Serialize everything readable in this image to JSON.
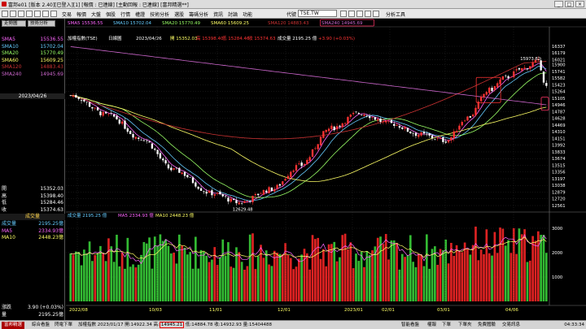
{
  "window": {
    "title": "富邦e01 [版本 2.40][已登入][1] [報價 : 已連線] [主動回報 : 已連線] [富邦精選**]",
    "buttons": [
      "_",
      "□",
      "×"
    ]
  },
  "toolbar": {
    "menus": [
      "交易",
      "報價",
      "大盤",
      "個股",
      "行情",
      "權證",
      "技術分析",
      "選股",
      "籌碼分析",
      "資訊",
      "討論",
      "功能"
    ],
    "symbol_label": "代號",
    "symbol": "TSE.TW",
    "analysis_tool": "分析工具"
  },
  "left_panel": {
    "tabs": [
      "走勢圖",
      "技術分析"
    ],
    "ma_rows": [
      {
        "name": "SMA5",
        "value": "15536.55",
        "color": "#ff66ff"
      },
      {
        "name": "SMA10",
        "value": "15702.04",
        "color": "#66ccff"
      },
      {
        "name": "SMA20",
        "value": "15770.49",
        "color": "#99ff66"
      },
      {
        "name": "SMA60",
        "value": "15609.25",
        "color": "#ffff66"
      },
      {
        "name": "SMA120",
        "value": "14883.43",
        "color": "#cc3333"
      },
      {
        "name": "SMA240",
        "value": "14945.69",
        "color": "#cc66cc"
      }
    ],
    "date": "2023/04/26",
    "ohlc": [
      {
        "k": "開",
        "v": "15352.03",
        "color": "#ffffff"
      },
      {
        "k": "高",
        "v": "15398.40",
        "color": "#ffffff"
      },
      {
        "k": "低",
        "v": "15284.46",
        "color": "#ffffff"
      },
      {
        "k": "收",
        "v": "15374.63",
        "color": "#ffffff"
      }
    ],
    "volume_header": "成交量",
    "vol_rows": [
      {
        "k": "成交量",
        "v": "2195.25億",
        "color": "#66ccff"
      },
      {
        "k": "MA5",
        "v": "2334.93億",
        "color": "#ff66ff"
      },
      {
        "k": "MA10",
        "v": "2448.23億",
        "color": "#ffff66"
      }
    ],
    "bottom_rows": [
      {
        "k": "漲跌",
        "v": "3.90 (+0.03%)",
        "color": "#ffffff"
      },
      {
        "k": "量",
        "v": "2195.25億",
        "color": "#ffffff"
      }
    ]
  },
  "chart_data": {
    "type": "candlestick",
    "title": "加權指數(TSE)",
    "period": "日線圖",
    "date": "2023/04/26",
    "open": "15352.03",
    "high": "15398.40",
    "low": "15284.46",
    "close": "15374.63",
    "vol_label": "成交量",
    "volume_text": "2195.25 億",
    "change": "+3.90 (+0.03%)",
    "ma_legend": [
      {
        "name": "SMA5",
        "value": "15536.55",
        "color": "#ff66ff"
      },
      {
        "name": "SMA10",
        "value": "15702.04",
        "color": "#66ccff"
      },
      {
        "name": "SMA20",
        "value": "15770.49",
        "color": "#99ff66"
      },
      {
        "name": "SMA60",
        "value": "15609.25",
        "color": "#ffff66"
      },
      {
        "name": "SMA120",
        "value": "14883.43",
        "color": "#cc3333"
      },
      {
        "name": "SMA240",
        "value": "14945.69",
        "color": "#cc66cc"
      }
    ],
    "y_ticks": [
      16337,
      16179,
      16021,
      15900,
      15741,
      15582,
      15423,
      15264,
      15105,
      14946,
      14787,
      14628,
      14469,
      14310,
      14151,
      13992,
      13833,
      13674,
      13515,
      13356,
      13197,
      13038,
      12879,
      12720,
      12561
    ],
    "y_range": [
      12561,
      16337
    ],
    "x_labels": [
      "2022/08",
      "10/03",
      "11/01",
      "12/01",
      "2023/01",
      "02/01",
      "03/01",
      "04/06"
    ],
    "annotations": [
      {
        "text": "15973.82",
        "value": 15973.82
      },
      {
        "text": "12629.48",
        "value": 12629.48
      }
    ],
    "volume_panel": {
      "legend": [
        {
          "name": "成交量",
          "value": "2195.25 億",
          "color": "#66ccff"
        },
        {
          "name": "MA5",
          "value": "2334.93 億",
          "color": "#ff66ff"
        },
        {
          "name": "MA10",
          "value": "2448.23 億",
          "color": "#ffff66"
        }
      ],
      "y_ticks": [
        3000,
        2000,
        1000
      ],
      "y_range": [
        0,
        3400
      ]
    },
    "colors": {
      "up": "#ff3333",
      "down": "#ffffff",
      "vol_up": "#dd2222",
      "vol_down": "#33bb33",
      "axis": "#ffffff",
      "grid": "#333333"
    }
  },
  "statusbar": {
    "tabs": [
      "富邦精選",
      "綜合看盤",
      "閃電下單"
    ],
    "ticker_pre": "加權指數 2023/01/17 開:14922.34 高:",
    "ticker_hl": "14945.21",
    "ticker_post": " 低:14884.78 收:14932.93 量:15404488",
    "right_buttons": [
      "智能看盤",
      "權報",
      "下單",
      "下單夾",
      "免費體驗",
      "交易訊息"
    ],
    "time": "04:33:34"
  }
}
